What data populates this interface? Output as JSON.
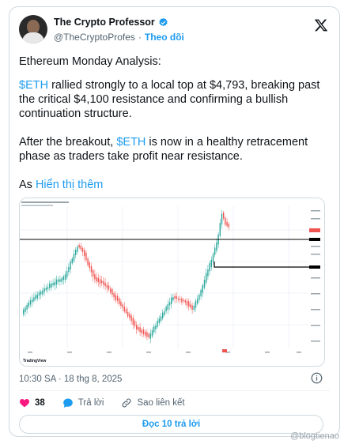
{
  "author": {
    "name": "The Crypto Professor",
    "handle": "@TheCryptoProfes",
    "separator": "·",
    "follow_label": "Theo dõi"
  },
  "post": {
    "p1": "Ethereum Monday Analysis:",
    "p2_tag": "$ETH",
    "p2_rest": " rallied strongly to a local top at $4,793, breaking past the critical $4,100 resistance and confirming a bullish continuation structure.",
    "p3_lead": "After the breakout, ",
    "p3_tag": "$ETH",
    "p3_rest": " is now in a healthy retracement phase as traders take profit near resistance.",
    "p4_lead": "As ",
    "show_more": "Hiển thị thêm"
  },
  "chart_image": {
    "brand": "TradingView",
    "colors": {
      "up": "#26a69a",
      "down": "#ef5350",
      "level": "#000000",
      "grid": "#f0f3fa"
    }
  },
  "meta": {
    "timestamp": "10:30 SA · 18 thg 8, 2025"
  },
  "actions": {
    "likes": "38",
    "reply_label": "Trả lời",
    "copy_link_label": "Sao liên kết"
  },
  "read_replies_label": "Đọc 10 trả lời",
  "watermark": "@blogtienao",
  "icons": [
    "verified-badge-icon",
    "x-logo-icon",
    "info-icon",
    "heart-icon",
    "reply-bubble-icon",
    "link-icon"
  ]
}
